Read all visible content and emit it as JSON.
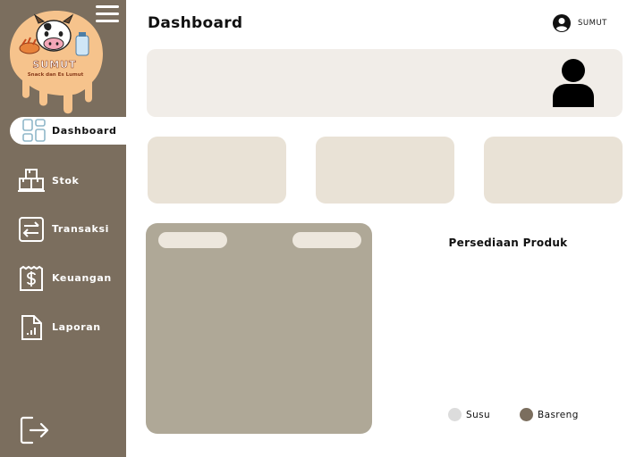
{
  "brand": {
    "name": "SUMUT",
    "tagline": "Snack dan Es Lumut"
  },
  "header": {
    "title": "Dashboard",
    "user_name": "SUMUT"
  },
  "sidebar": {
    "items": [
      {
        "label": "Dashboard",
        "icon": "dashboard-grid-icon",
        "active": true
      },
      {
        "label": "Stok",
        "icon": "boxes-icon",
        "active": false
      },
      {
        "label": "Transaksi",
        "icon": "transfer-icon",
        "active": false
      },
      {
        "label": "Keuangan",
        "icon": "receipt-dollar-icon",
        "active": false
      },
      {
        "label": "Laporan",
        "icon": "report-document-icon",
        "active": false
      }
    ],
    "logout_icon": "logout-icon"
  },
  "chart": {
    "title": "Persediaan Produk",
    "legend": [
      {
        "label": "Susu",
        "color": "#dcdcdc"
      },
      {
        "label": "Basreng",
        "color": "#7b6e5e"
      }
    ]
  },
  "colors": {
    "sidebar": "#7b6e5e",
    "banner": "#f1ede8",
    "card": "#e9e2d6",
    "panel": "#afa897"
  }
}
